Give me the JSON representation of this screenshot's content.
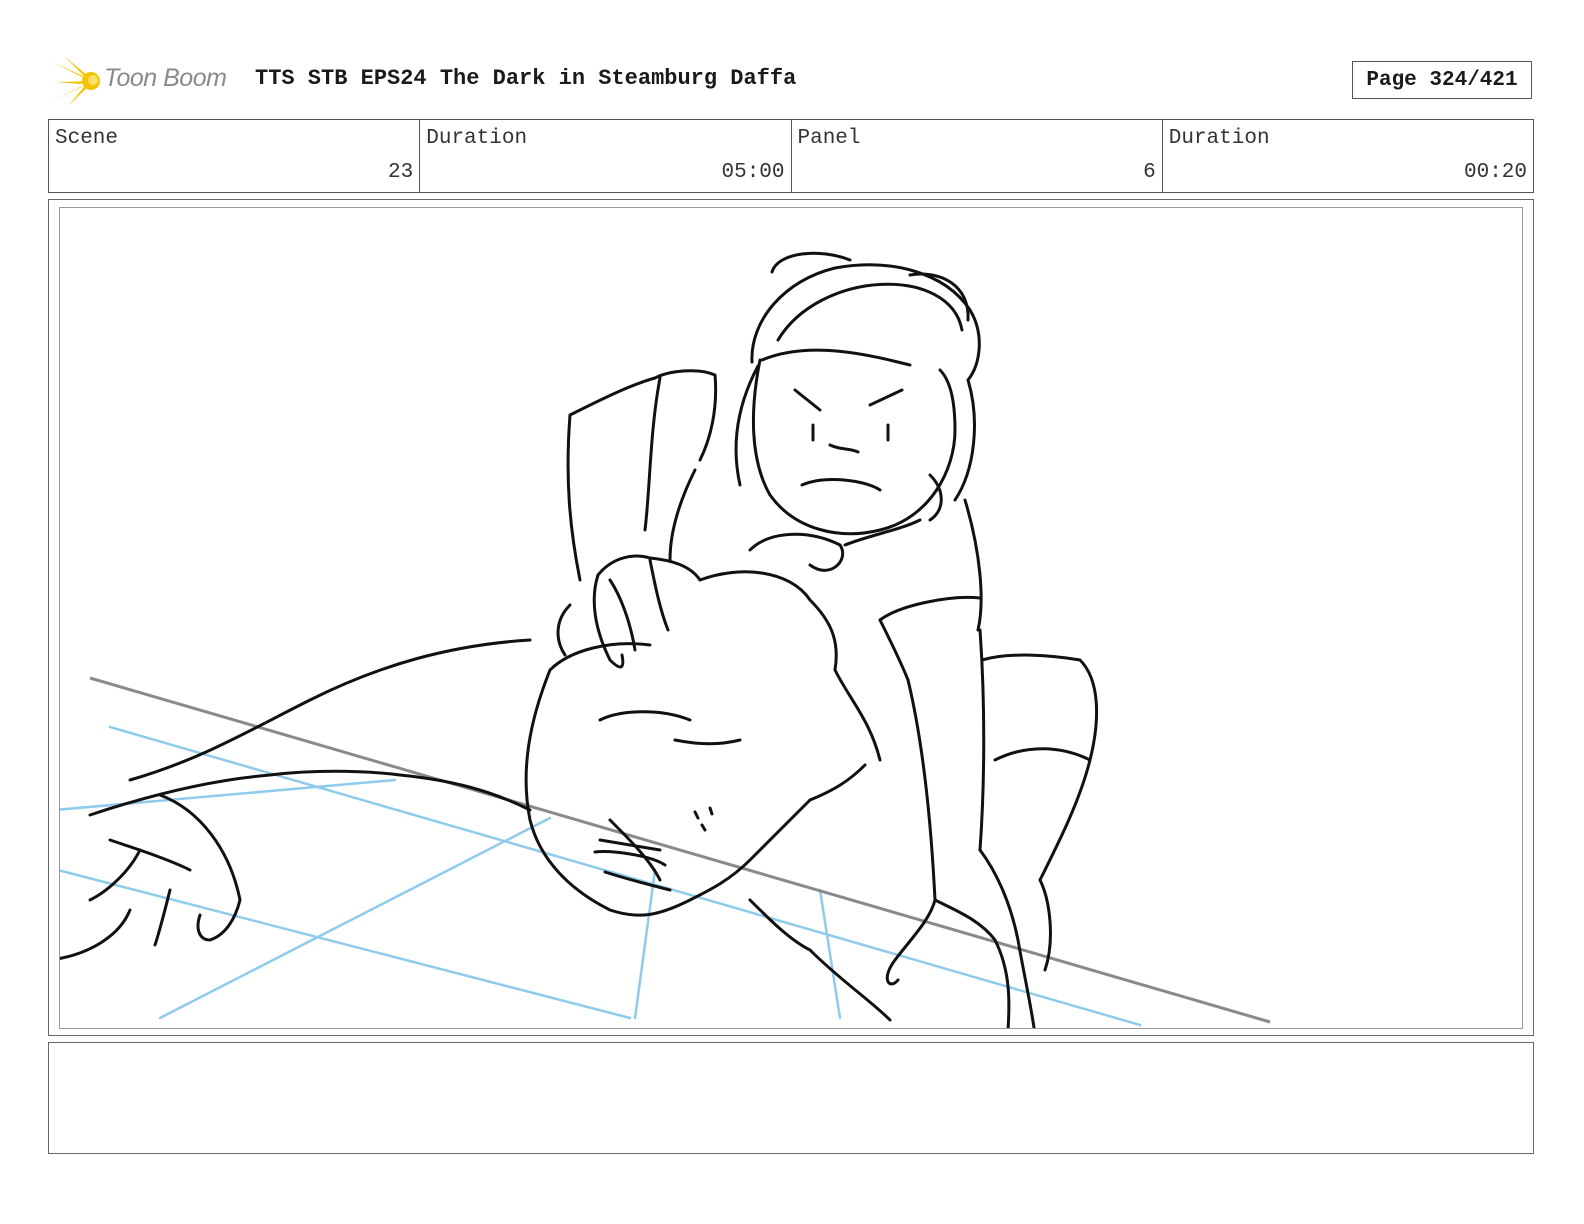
{
  "header": {
    "logo_text": "Toon Boom",
    "title": "TTS STB EPS24 The Dark in Steamburg Daffa",
    "page_label": "Page 324/421"
  },
  "info": {
    "scene_label": "Scene",
    "scene_value": "23",
    "scene_duration_label": "Duration",
    "scene_duration_value": "05:00",
    "panel_label": "Panel",
    "panel_value": "6",
    "panel_duration_label": "Duration",
    "panel_duration_value": "00:20"
  },
  "colors": {
    "logo_yellow": "#f5c400",
    "sketch_ink": "#111111",
    "perspective_blue": "#8fcbec",
    "horizon_gray": "#8a8a8a"
  },
  "icons": {
    "logo": "toon-boom-starburst-icon"
  },
  "notes": {
    "text": ""
  }
}
